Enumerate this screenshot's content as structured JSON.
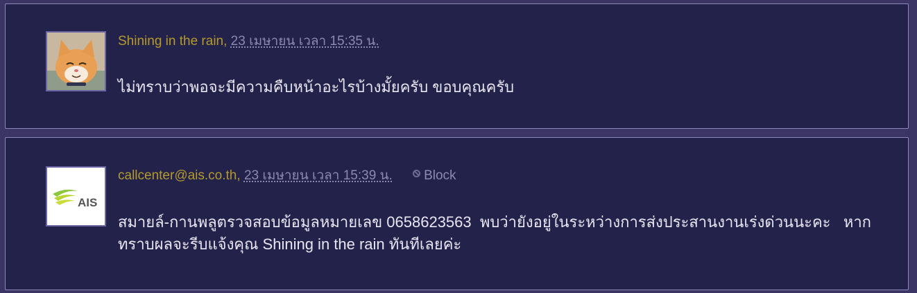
{
  "comments": [
    {
      "author": "Shining in the rain",
      "separator": ",",
      "date": "23 เมษายน เวลา 15:35 น.",
      "text": "ไม่ทราบว่าพอจะมีความคืบหน้าอะไรบ้างมั้ยครับ ขอบคุณครับ",
      "avatar": "cat-avatar"
    },
    {
      "author": "callcenter@ais.co.th",
      "separator": ",",
      "date": "23 เมษายน เวลา 15:39 น.",
      "block_label": "Block",
      "text": "สมายล์-กานพลูตรวจสอบข้อมูลหมายเลข 0658623563  พบว่ายังอยู่ในระหว่างการส่งประสานงานเร่งด่วนนะคะ   หากทราบผลจะรีบแจ้งคุณ Shining in the rain ทันทีเลยค่ะ",
      "avatar": "ais-logo",
      "avatar_text": "AIS"
    }
  ],
  "colors": {
    "author": "#b59a2c",
    "date": "#8c89b3",
    "body_text": "#e8e6f2",
    "panel_bg": "#23224a",
    "page_bg": "#3a3562"
  }
}
